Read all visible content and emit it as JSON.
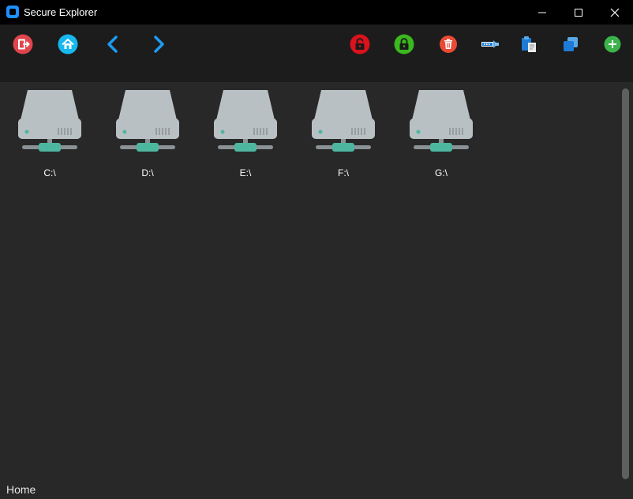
{
  "window": {
    "title": "Secure Explorer"
  },
  "toolbar": {
    "left_icons": [
      "logout-icon",
      "home-icon",
      "back-arrow-icon",
      "forward-arrow-icon"
    ],
    "right_icons": [
      "unlock-icon",
      "lock-icon",
      "delete-icon",
      "rename-icon",
      "paste-icon",
      "copy-icon",
      "add-icon"
    ]
  },
  "drives": [
    {
      "label": "C:\\"
    },
    {
      "label": "D:\\"
    },
    {
      "label": "E:\\"
    },
    {
      "label": "F:\\"
    },
    {
      "label": "G:\\"
    }
  ],
  "status": {
    "text": "Home"
  },
  "colors": {
    "accent_blue": "#1e9bef",
    "lock_red": "#d9121c",
    "lock_green": "#3bb71f",
    "delete_red": "#e94a35",
    "add_green": "#3cb24b",
    "drive_body": "#b9c0c3",
    "drive_teal": "#4db69f"
  }
}
